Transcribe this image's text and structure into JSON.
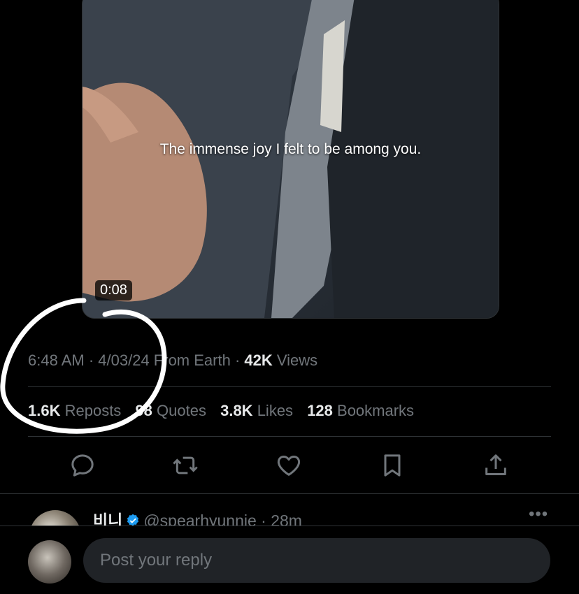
{
  "media": {
    "caption": "The immense joy I felt to be among you.",
    "duration": "0:08"
  },
  "meta": {
    "time": "6:48 AM",
    "sep1": " · ",
    "date": "4/03/24",
    "source": " From Earth",
    "sep2": " · ",
    "views_count": "42K",
    "views_label": " Views"
  },
  "stats": [
    {
      "count": "1.6K",
      "label": " Reposts"
    },
    {
      "count": "98",
      "label": " Quotes"
    },
    {
      "count": "3.8K",
      "label": " Likes"
    },
    {
      "count": "128",
      "label": " Bookmarks"
    }
  ],
  "actions": [
    "reply-icon",
    "repost-icon",
    "like-icon",
    "bookmark-icon",
    "share-icon"
  ],
  "reply": {
    "name": "비니",
    "handle": "@spearhyunnie",
    "time": " · 28m",
    "more": "•••"
  },
  "composer": {
    "placeholder": "Post your reply"
  },
  "colors": {
    "background": "#000000",
    "text": "#e7e9ea",
    "muted": "#71767b",
    "divider": "#2f3336",
    "verified": "#1d9bf0",
    "annotation": "#ffffff"
  }
}
